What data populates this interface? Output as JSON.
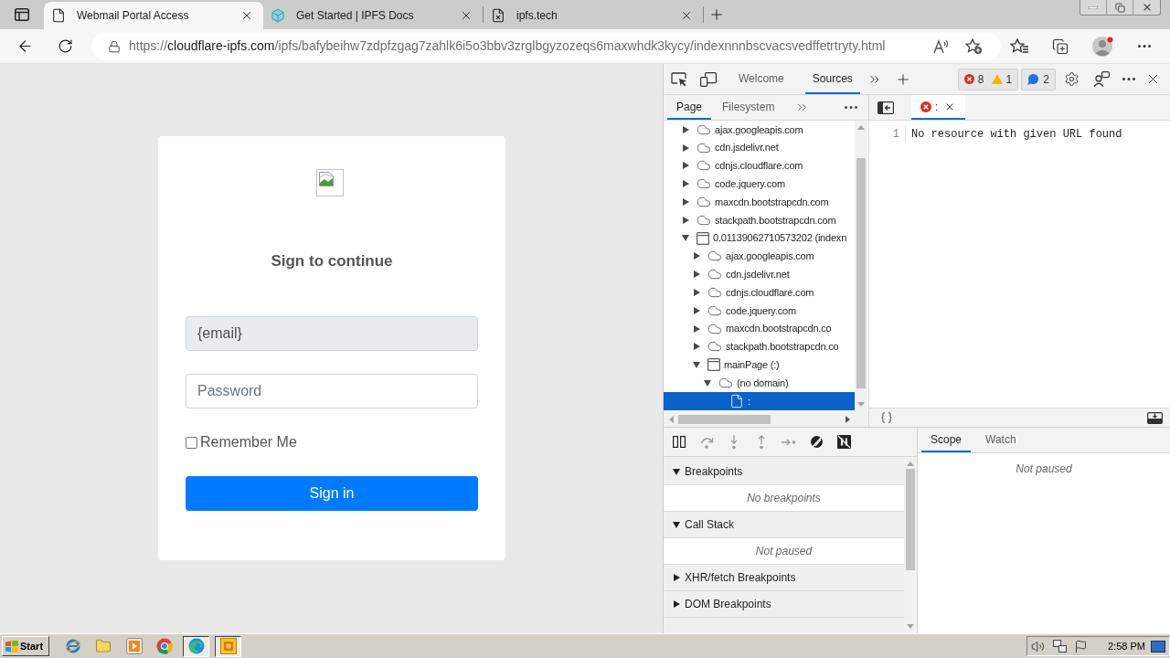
{
  "browser": {
    "tabs": [
      {
        "title": "Webmail Portal Access",
        "kind": "page",
        "selected": true
      },
      {
        "title": "Get Started | IPFS Docs",
        "kind": "cube",
        "selected": false
      },
      {
        "title": "ipfs.tech",
        "kind": "error",
        "selected": false
      }
    ],
    "address_bar": {
      "scheme": "https://",
      "host": "cloudflare-ipfs.com",
      "path": "/ipfs/bafybeihw7zdpfzgag7zahlk6i5o3bbv3zrglbgyzozeqs6maxwhdk3kycy/indexnnnbscvacsvedffetrtryty.html"
    }
  },
  "page": {
    "heading": "Sign to continue",
    "email": {
      "value": "{email}",
      "disabled": true
    },
    "password": {
      "placeholder": "Password"
    },
    "remember": {
      "label": "Remember Me",
      "checked": false
    },
    "submit": "Sign in"
  },
  "devtools": {
    "tabs": [
      {
        "label": "Welcome",
        "selected": false
      },
      {
        "label": "Sources",
        "selected": true
      }
    ],
    "issues": {
      "errors": "8",
      "warnings": "1",
      "info": "2"
    },
    "navigator": {
      "tabs": [
        {
          "label": "Page",
          "selected": true
        },
        {
          "label": "Filesystem",
          "selected": false
        }
      ],
      "tree": [
        {
          "label": "ajax.googleapis.com",
          "kind": "domain",
          "expanded": false,
          "selected": false
        },
        {
          "label": "cdn.jsdelivr.net",
          "kind": "domain",
          "expanded": false,
          "selected": false
        },
        {
          "label": "cdnjs.cloudflare.com",
          "kind": "domain",
          "expanded": false,
          "selected": false
        },
        {
          "label": "code.jquery.com",
          "kind": "domain",
          "expanded": false,
          "selected": false
        },
        {
          "label": "maxcdn.bootstrapcdn.com",
          "kind": "domain",
          "expanded": false,
          "selected": false
        },
        {
          "label": "stackpath.bootstrapcdn.com",
          "kind": "domain",
          "expanded": false,
          "selected": false
        },
        {
          "label": "0.01139062710573202 (indexn",
          "kind": "frame",
          "expanded": true,
          "selected": false,
          "children": [
            {
              "label": "ajax.googleapis.com",
              "kind": "domain",
              "expanded": false,
              "selected": false
            },
            {
              "label": "cdn.jsdelivr.net",
              "kind": "domain",
              "expanded": false,
              "selected": false
            },
            {
              "label": "cdnjs.cloudflare.com",
              "kind": "domain",
              "expanded": false,
              "selected": false
            },
            {
              "label": "code.jquery.com",
              "kind": "domain",
              "expanded": false,
              "selected": false
            },
            {
              "label": "maxcdn.bootstrapcdn.co",
              "kind": "domain",
              "expanded": false,
              "selected": false
            },
            {
              "label": "stackpath.bootstrapcdn.co",
              "kind": "domain",
              "expanded": false,
              "selected": false
            },
            {
              "label": "mainPage (:)",
              "kind": "frame",
              "expanded": true,
              "selected": false,
              "children": [
                {
                  "label": "(no domain)",
                  "kind": "domain",
                  "expanded": true,
                  "selected": false,
                  "children": [
                    {
                      "label": ":",
                      "kind": "file",
                      "selected": true
                    }
                  ]
                }
              ]
            }
          ]
        }
      ]
    },
    "editor": {
      "tabs": [
        {
          "label": ":",
          "error": true,
          "selected": true
        }
      ],
      "lines": [
        {
          "number": "1",
          "text": "No resource with given URL found"
        }
      ]
    },
    "debugger": {
      "sections": [
        {
          "title": "Breakpoints",
          "expanded": true,
          "message": "No breakpoints"
        },
        {
          "title": "Call Stack",
          "expanded": true,
          "message": "Not paused"
        },
        {
          "title": "XHR/fetch Breakpoints",
          "expanded": false
        },
        {
          "title": "DOM Breakpoints",
          "expanded": false
        }
      ]
    },
    "sidebar": {
      "tabs": [
        {
          "label": "Scope",
          "selected": true
        },
        {
          "label": "Watch",
          "selected": false
        }
      ],
      "message": "Not paused"
    }
  },
  "taskbar": {
    "start": "Start",
    "apps": [
      {
        "kind": "ie",
        "pressed": false
      },
      {
        "kind": "folder",
        "pressed": false
      },
      {
        "kind": "media",
        "pressed": false
      },
      {
        "kind": "chrome",
        "pressed": false
      },
      {
        "kind": "edge",
        "pressed": true
      },
      {
        "kind": "office",
        "pressed": true
      }
    ],
    "clock": "2:58 PM"
  }
}
